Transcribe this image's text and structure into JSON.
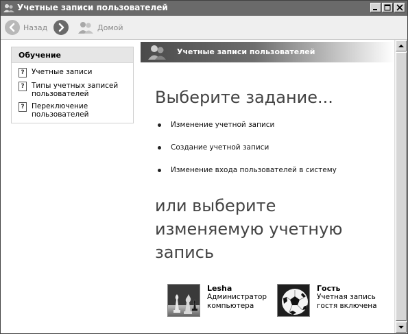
{
  "window": {
    "title": "Учетные записи пользователей"
  },
  "toolbar": {
    "back_label": "Назад",
    "home_label": "Домой"
  },
  "learn": {
    "title": "Обучение",
    "items": [
      {
        "label": "Учетные записи"
      },
      {
        "label": "Типы учетных записей пользователей"
      },
      {
        "label": "Переключение пользователей"
      }
    ]
  },
  "main": {
    "band_title": "Учетные записи пользователей",
    "heading_task": "Выберите задание...",
    "tasks": [
      {
        "label": "Изменение учетной записи"
      },
      {
        "label": "Создание учетной записи"
      },
      {
        "label": "Изменение входа пользователей в систему"
      }
    ],
    "heading_account": "или выберите изменяемую учетную запись",
    "accounts": [
      {
        "name": "Lesha",
        "desc": "Администратор компьютера",
        "picture": "chess-pieces"
      },
      {
        "name": "Гость",
        "desc": "Учетная запись гостя включена",
        "picture": "soccer-ball"
      }
    ]
  },
  "icons": {
    "back": "back-arrow-icon",
    "forward": "forward-arrow-icon",
    "home": "users-home-icon",
    "help": "question-icon"
  },
  "colors": {
    "titlebar": "#6a6a6a",
    "toolbar": "#efefef",
    "band_dark": "#4a4a4a"
  }
}
